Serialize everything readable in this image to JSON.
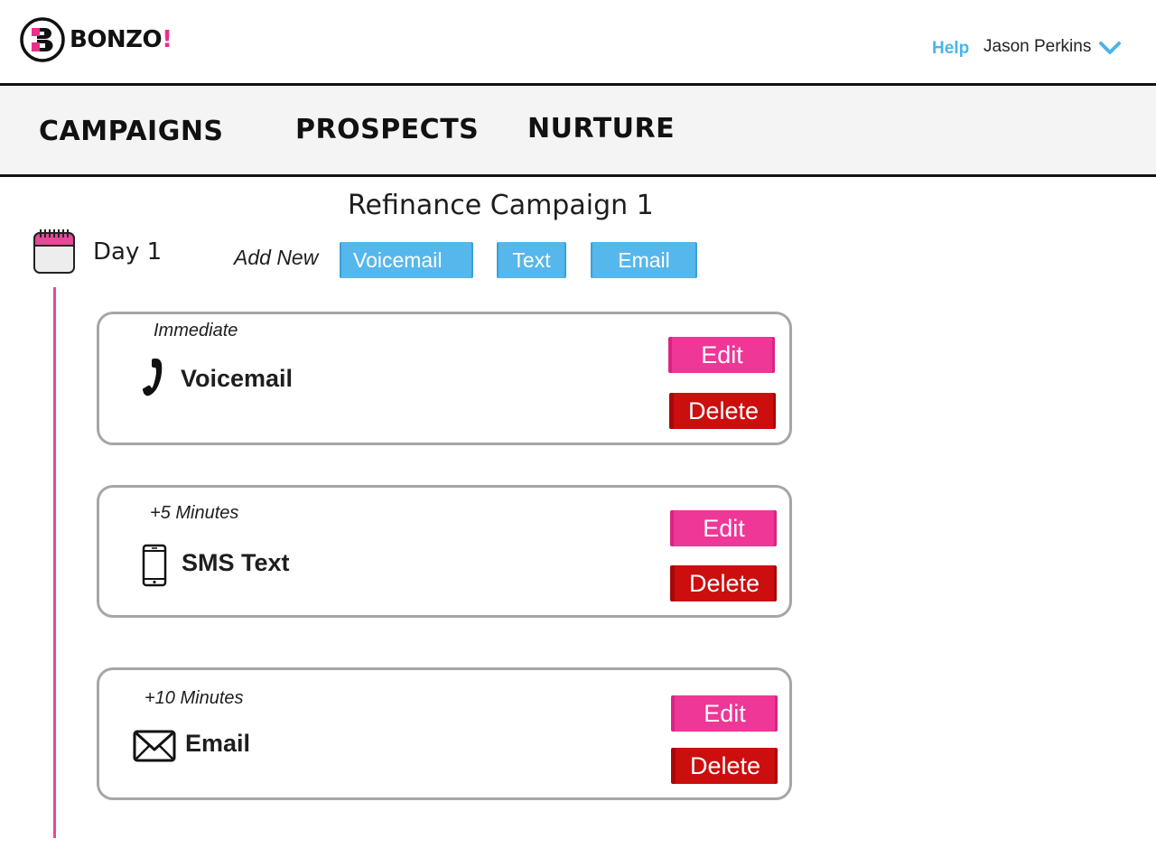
{
  "header": {
    "brand_name": "BONZO",
    "brand_suffix": "!",
    "help_label": "Help",
    "user_name": "Jason Perkins",
    "icons": {
      "menu_caret": "chevron-down-icon",
      "logo": "bonzo-b-logo"
    }
  },
  "nav": {
    "tabs": [
      {
        "label": "CAMPAIGNS"
      },
      {
        "label": "PROSPECTS"
      },
      {
        "label": "NURTURE"
      }
    ]
  },
  "campaign": {
    "title": "Refinance Campaign 1",
    "day_label": "Day 1",
    "add_new_label": "Add New",
    "add_buttons": [
      {
        "label": "Voicemail"
      },
      {
        "label": "Text"
      },
      {
        "label": "Email"
      }
    ]
  },
  "steps": [
    {
      "timing": "Immediate",
      "type": "Voicemail",
      "icon": "phone-icon",
      "edit_label": "Edit",
      "delete_label": "Delete"
    },
    {
      "timing": "+5 Minutes",
      "type": "SMS Text",
      "icon": "mobile-phone-icon",
      "edit_label": "Edit",
      "delete_label": "Delete"
    },
    {
      "timing": "+10 Minutes",
      "type": "Email",
      "icon": "envelope-icon",
      "edit_label": "Edit",
      "delete_label": "Delete"
    }
  ],
  "colors": {
    "brand_pink": "#ea2f8c",
    "accent_blue": "#56b7ec",
    "help_blue": "#4ab5e9",
    "edit_pink": "#ee3797",
    "delete_red": "#cc0e0e",
    "timeline_pink": "#e8479a",
    "card_border": "#a6a6a6",
    "nav_background": "#f4f4f4"
  }
}
